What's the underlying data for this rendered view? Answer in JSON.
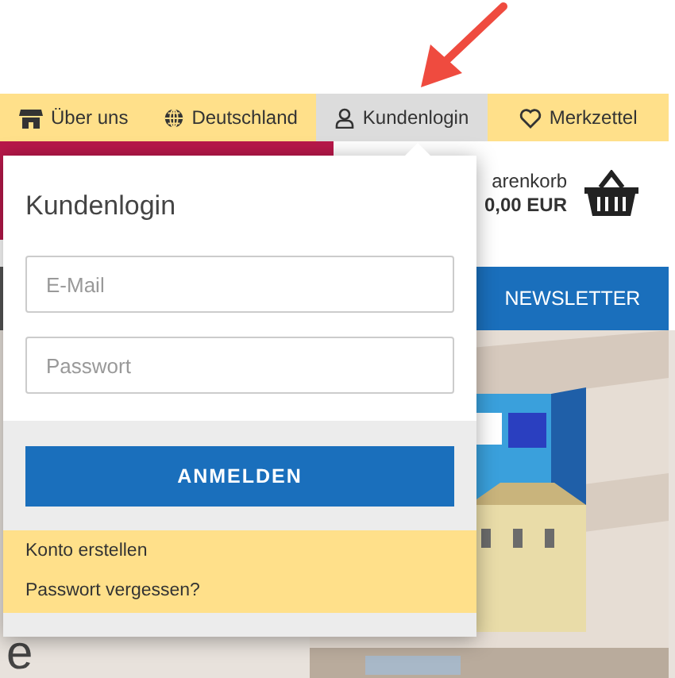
{
  "nav": [
    {
      "kind": "shop",
      "label": "Über uns",
      "selected": false
    },
    {
      "kind": "globe",
      "label": "Deutschland",
      "selected": false
    },
    {
      "kind": "user",
      "label": "Kundenlogin",
      "selected": true
    },
    {
      "kind": "heart",
      "label": "Merkzettel",
      "selected": false
    }
  ],
  "cart": {
    "label": "arenkorb",
    "total": "0,00 EUR"
  },
  "newsletter": "NEWSLETTER",
  "hero": {
    "text": "e"
  },
  "login": {
    "title": "Kundenlogin",
    "fields": [
      {
        "placeholder": "E-Mail"
      },
      {
        "placeholder": "Passwort"
      }
    ],
    "button": "ANMELDEN",
    "links": [
      "Konto erstellen",
      "Passwort vergessen?"
    ]
  }
}
